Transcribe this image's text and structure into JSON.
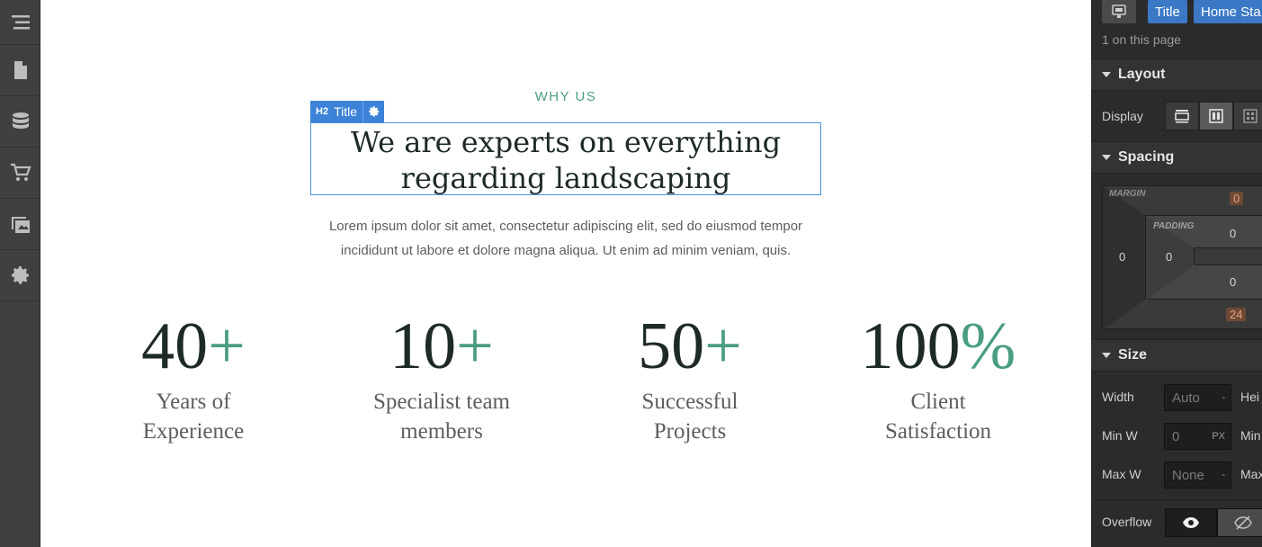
{
  "left_toolbar": {
    "icons": [
      "navigator-icon",
      "pages-icon",
      "cms-icon",
      "ecommerce-icon",
      "assets-icon",
      "settings-icon"
    ]
  },
  "canvas": {
    "eyebrow": "WHY US",
    "selection": {
      "tag": "H2",
      "label": "Title"
    },
    "headline_line1": "We are experts on everything",
    "headline_line2": "regarding landscaping",
    "lead_line1": "Lorem ipsum dolor sit amet, consectetur adipiscing elit, sed do eiusmod tempor",
    "lead_line2": "incididunt ut labore et dolore magna aliqua. Ut enim ad minim veniam, quis.",
    "stats": [
      {
        "number": "40",
        "suffix": "+",
        "label1": "Years of",
        "label2": "Experience"
      },
      {
        "number": "10",
        "suffix": "+",
        "label1": "Specialist team",
        "label2": "members"
      },
      {
        "number": "50",
        "suffix": "+",
        "label1": "Successful",
        "label2": "Projects"
      },
      {
        "number": "100",
        "suffix": "%",
        "label1": "Client",
        "label2": "Satisfaction"
      }
    ],
    "accent_color": "#4a9e7f"
  },
  "right_panel": {
    "chips": [
      "Title",
      "Home Sta"
    ],
    "count_text": "1 on this page",
    "sections": {
      "layout": "Layout",
      "spacing": "Spacing",
      "size": "Size"
    },
    "display_label": "Display",
    "spacing": {
      "margin_label": "MARGIN",
      "padding_label": "PADDING",
      "margin_top": "0",
      "margin_left": "0",
      "margin_bottom": "24",
      "padding_top": "0",
      "padding_left": "0",
      "padding_bottom": "0"
    },
    "size": {
      "width_label": "Width",
      "width_value": "Auto",
      "width_unit": "-",
      "height_label": "Hei",
      "min_w_label": "Min W",
      "min_w_value": "0",
      "min_w_unit": "PX",
      "min_h_label": "Min",
      "max_w_label": "Max W",
      "max_w_value": "None",
      "max_w_unit": "-",
      "max_h_label": "Max"
    },
    "overflow_label": "Overflow"
  }
}
